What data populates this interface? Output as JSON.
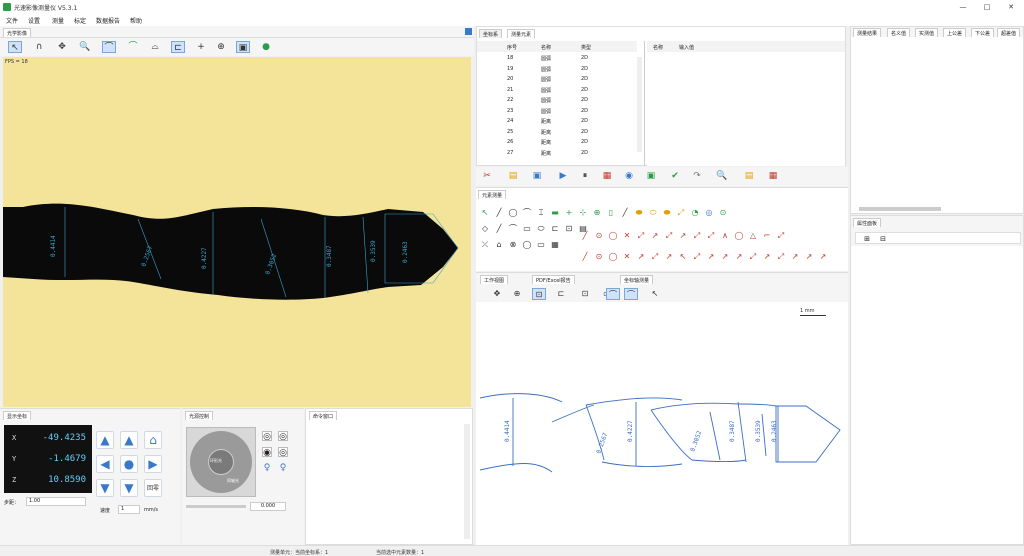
{
  "app": {
    "title": "光速影像测量仪 V5.3.1",
    "window_buttons": [
      "—",
      "□",
      "✕"
    ]
  },
  "menu": [
    "文件",
    "设置",
    "测量",
    "标定",
    "数据报告",
    "帮助"
  ],
  "left_tab": "光学影像",
  "fps": "FPS = 18",
  "image_tools": [
    "↖",
    "∩",
    "✥",
    "🔍",
    "⌒",
    "⌒",
    "⌓",
    "⊏",
    "+",
    "⊕",
    "▣",
    "●"
  ],
  "measurements": [
    "0.4414",
    "0.2567",
    "0.4227",
    "0.3052",
    "0.3487",
    "0.3539",
    "0.2463"
  ],
  "grid": {
    "tabs": [
      "坐标系",
      "测量元素"
    ],
    "headers": [
      "序号",
      "名称",
      "类型"
    ],
    "rows": [
      {
        "id": "18",
        "name": "圆弧",
        "type": "2D"
      },
      {
        "id": "19",
        "name": "圆弧",
        "type": "2D"
      },
      {
        "id": "20",
        "name": "圆弧",
        "type": "2D"
      },
      {
        "id": "21",
        "name": "圆弧",
        "type": "2D"
      },
      {
        "id": "22",
        "name": "圆弧",
        "type": "2D"
      },
      {
        "id": "23",
        "name": "圆弧",
        "type": "2D"
      },
      {
        "id": "24",
        "name": "距离",
        "type": "2D"
      },
      {
        "id": "25",
        "name": "距离",
        "type": "2D"
      },
      {
        "id": "26",
        "name": "距离",
        "type": "2D"
      },
      {
        "id": "27",
        "name": "距离",
        "type": "2D"
      }
    ]
  },
  "detail_headers": [
    "名称",
    "输入值"
  ],
  "right_headers": [
    "测量结果",
    "名义值",
    "实测值",
    "上公差",
    "下公差",
    "超差值"
  ],
  "element_tab": "元素测量",
  "prop_tab": "属性面板",
  "scale_label": "1 mm",
  "bottom_tabs": [
    "工作视图",
    "PDF/Excel报告",
    "坐标轴测量"
  ],
  "dro": {
    "title": "显示坐标",
    "rows": [
      {
        "axis": "X",
        "value": "-49.4235"
      },
      {
        "axis": "Y",
        "value": "-1.4679"
      },
      {
        "axis": "Z",
        "value": "10.8590"
      }
    ],
    "step_label": "步距：",
    "step_value": "1.00"
  },
  "motion": {
    "title": "光源控制",
    "labels": [
      "环形光",
      "同轴光"
    ],
    "slider_value": "0.000"
  },
  "log": {
    "title": "命令窗口"
  },
  "control": {
    "speed_label": "速度",
    "speed_value": "1",
    "unit": "mm/s",
    "home": "回零"
  },
  "status": {
    "left": "测量单元：当前坐标系：1",
    "right": "当前选中元素数量：1"
  },
  "colors": {
    "yellow": "#f3e49a",
    "dim": "#3a78c9",
    "toolbar_red": "#c0392b"
  }
}
